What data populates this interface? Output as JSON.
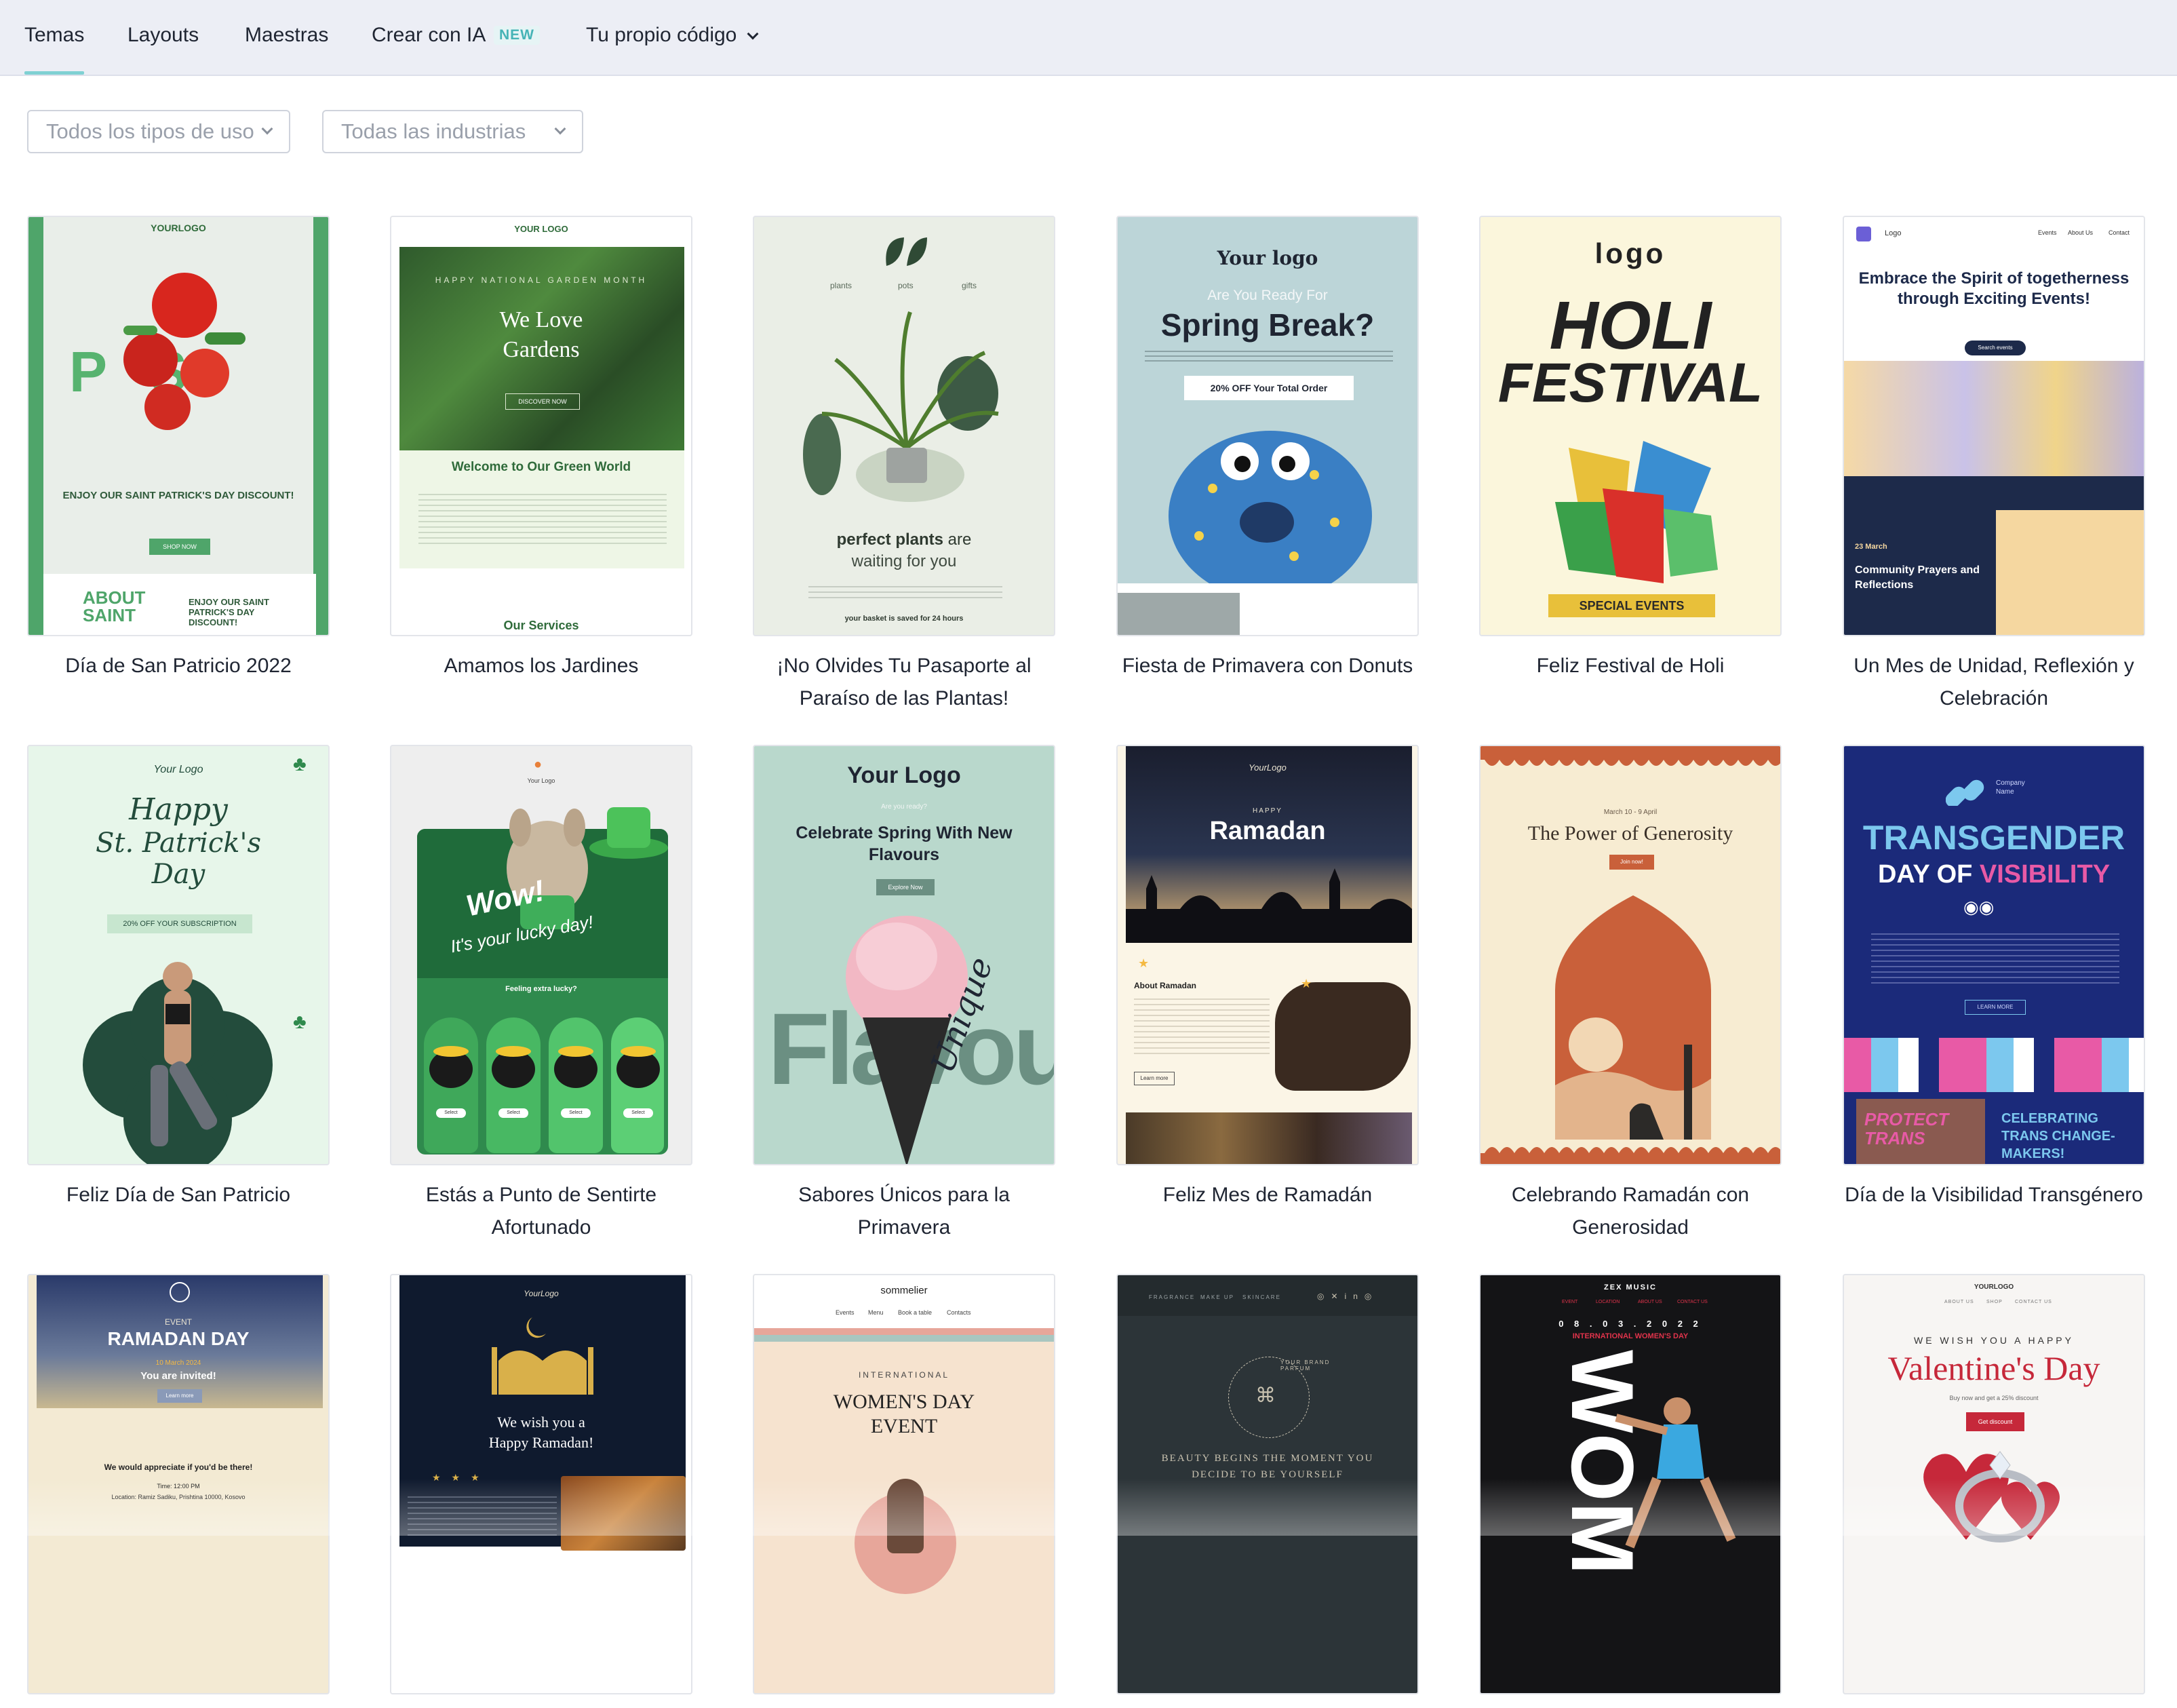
{
  "tabs": [
    {
      "label": "Temas",
      "active": true
    },
    {
      "label": "Layouts",
      "active": false
    },
    {
      "label": "Maestras",
      "active": false
    },
    {
      "label": "Crear con IA",
      "active": false,
      "badge": "NEW"
    },
    {
      "label": "Tu propio código",
      "active": false,
      "dropdown": true
    }
  ],
  "filters": {
    "usage_placeholder": "Todos los tipos de uso",
    "industry_placeholder": "Todas las industrias"
  },
  "templates": [
    {
      "caption": "Día de San Patricio 2022",
      "thumb": {
        "logo": "YOURLOGO",
        "headline": "ENJOY OUR SAINT PATRICK'S DAY DISCOUNT!",
        "cta": "SHOP NOW",
        "footer": "ENJOY OUR SAINT PATRICK'S DAY DISCOUNT!",
        "side": "ABOUT SAINT"
      },
      "colors": {
        "bg": "#e9eee9",
        "accent": "#4fa56a"
      }
    },
    {
      "caption": "Amamos los Jardines",
      "thumb": {
        "logo": "YOUR LOGO",
        "kicker": "HAPPY NATIONAL GARDEN MONTH",
        "headline": "We Love Gardens",
        "cta": "DISCOVER NOW",
        "sub": "Welcome to Our Green World",
        "footer": "Our Services"
      },
      "colors": {
        "bg": "#eef6e6",
        "accent": "#2f6b3a"
      }
    },
    {
      "caption": "¡No Olvides Tu Pasaporte al Paraíso de las Plantas!",
      "thumb": {
        "nav1": "plants",
        "nav2": "pots",
        "nav3": "gifts",
        "headline1": "perfect plants",
        "headline2": "are",
        "headline3": "waiting for you",
        "footer": "your basket is saved for 24 hours"
      },
      "colors": {
        "bg": "#eaeee6",
        "accent": "#3f5e45"
      }
    },
    {
      "caption": "Fiesta de Primavera con Donuts",
      "thumb": {
        "logo": "Your logo",
        "kicker": "Are You Ready For",
        "headline": "Spring Break?",
        "cta": "20% OFF Your Total Order"
      },
      "colors": {
        "bg": "#bcd5d8",
        "accent": "#3a7fc4"
      }
    },
    {
      "caption": "Feliz Festival de Holi",
      "thumb": {
        "logo": "logo",
        "headline1": "HOLI",
        "headline2": "FESTIVAL",
        "cta": "SPECIAL EVENTS"
      },
      "colors": {
        "bg": "#fbf6dc",
        "accent": "#e8c03a"
      }
    },
    {
      "caption": "Un Mes de Unidad, Reflexión y Celebración",
      "thumb": {
        "logo": "Logo",
        "nav1": "Events",
        "nav2": "About Us",
        "nav3": "Contact",
        "headline": "Embrace the Spirit of togetherness through Exciting Events!",
        "cta": "Search events",
        "date": "23 March",
        "sub": "Community Prayers and Reflections"
      },
      "colors": {
        "bg": "#ffffff",
        "accent": "#1d2a4a"
      }
    },
    {
      "caption": "Feliz Día de San Patricio",
      "thumb": {
        "logo": "Your Logo",
        "headline1": "Happy",
        "headline2": "St. Patrick's",
        "headline3": "Day",
        "cta": "20% OFF YOUR SUBSCRIPTION"
      },
      "colors": {
        "bg": "#e7f6ea",
        "accent": "#234c3c"
      }
    },
    {
      "caption": "Estás a Punto de Sentirte Afortunado",
      "thumb": {
        "logo": "Your Logo",
        "headline1": "Wow!",
        "headline2": "It's your lucky day!",
        "sub": "Feeling extra lucky?",
        "cta": "Select"
      },
      "colors": {
        "bg": "#eeeeee",
        "accent": "#2f8a4d"
      }
    },
    {
      "caption": "Sabores Únicos para la Primavera",
      "thumb": {
        "logo": "Your Logo",
        "kicker": "Are you ready?",
        "headline": "Celebrate Spring With New Flavours",
        "cta": "Explore Now",
        "big": "Flavour",
        "script": "Unique"
      },
      "colors": {
        "bg": "#b9d8cc",
        "accent": "#6b8f82"
      }
    },
    {
      "caption": "Feliz Mes de Ramadán",
      "thumb": {
        "logo": "YourLogo",
        "kicker": "HAPPY",
        "headline": "Ramadan",
        "sub": "About Ramadan",
        "cta": "Learn more"
      },
      "colors": {
        "bg": "#1a1e2e",
        "accent": "#f4b942"
      }
    },
    {
      "caption": "Celebrando Ramadán con Generosidad",
      "thumb": {
        "date": "March 10 - 9 April",
        "headline": "The Power of Generosity",
        "cta": "Join now!"
      },
      "colors": {
        "bg": "#f7ecd2",
        "accent": "#c9603a"
      }
    },
    {
      "caption": "Día de la Visibilidad Transgénero",
      "thumb": {
        "logo": "Company Name",
        "headline1": "TRANSGENDER",
        "headline2": "DAY OF",
        "headline3": "VISIBILITY",
        "cta": "LEARN MORE",
        "footer": "CELEBRATING TRANS CHANGE-MAKERS!",
        "sign": "PROTECT TRANS"
      },
      "colors": {
        "bg": "#1b2a7a",
        "accent": "#e85aa6"
      }
    },
    {
      "caption": "",
      "thumb": {
        "kicker": "EVENT",
        "headline": "RAMADAN DAY",
        "date": "10 March 2024",
        "sub": "You are invited!",
        "cta": "Learn more",
        "footer": "We would appreciate if you'd be there!",
        "time": "Time: 12:00 PM",
        "location": "Location: Ramiz Sadiku, Prishtina 10000, Kosovo"
      },
      "colors": {
        "bg": "#f3ead3",
        "accent": "#2a3a6a"
      }
    },
    {
      "caption": "",
      "thumb": {
        "logo": "YourLogo",
        "headline1": "We wish you a",
        "headline2": "Happy Ramadan!"
      },
      "colors": {
        "bg": "#0f1a2e",
        "accent": "#d9b04a"
      }
    },
    {
      "caption": "",
      "thumb": {
        "logo": "sommelier",
        "nav1": "Events",
        "nav2": "Menu",
        "nav3": "Book a table",
        "nav4": "Contacts",
        "kicker": "INTERNATIONAL",
        "headline1": "WOMEN'S DAY",
        "headline2": "EVENT"
      },
      "colors": {
        "bg": "#f6e3cf",
        "accent": "#e7a69a"
      }
    },
    {
      "caption": "",
      "thumb": {
        "nav1": "FRAGRANCE",
        "nav2": "MAKE UP",
        "nav3": "SKINCARE",
        "ring": "YOUR BRAND PARFUM",
        "headline": "BEAUTY BEGINS THE MOMENT YOU DECIDE TO BE YOURSELF"
      },
      "colors": {
        "bg": "#2c3438",
        "accent": "#c9c2b0"
      }
    },
    {
      "caption": "",
      "thumb": {
        "logo": "ZEX MUSIC",
        "nav1": "EVENT",
        "nav2": "LOCATION",
        "nav3": "ABOUT US",
        "nav4": "CONTACT US",
        "date": "0 8 . 0 3 . 2 0 2 2",
        "headline": "INTERNATIONAL WOMEN'S DAY",
        "big": "WOM"
      },
      "colors": {
        "bg": "#141416",
        "accent": "#e1334b"
      }
    },
    {
      "caption": "",
      "thumb": {
        "logo": "YOURLOGO",
        "nav1": "ABOUT US",
        "nav2": "SHOP",
        "nav3": "CONTACT US",
        "kicker": "WE WISH YOU A HAPPY",
        "headline": "Valentine's Day",
        "sub": "Buy now and get a 25% discount",
        "cta": "Get discount"
      },
      "colors": {
        "bg": "#f7f5f3",
        "accent": "#c6283a"
      }
    }
  ]
}
